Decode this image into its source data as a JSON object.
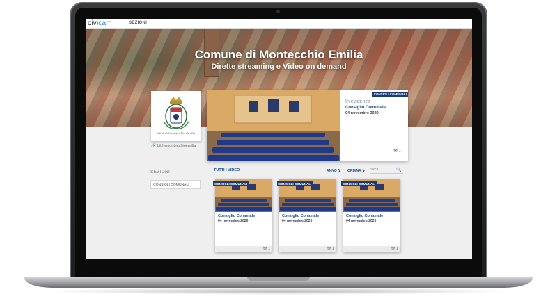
{
  "header": {
    "logo_prefix": "civi",
    "logo_accent": "cam",
    "nav_label": "SEZIONI"
  },
  "hero": {
    "title": "Comune di Montecchio Emilia",
    "subtitle": "Dirette streaming e Video on demand"
  },
  "crest": {
    "link_text": "bit.ly/montecchioemilia",
    "crest_text": "Città di Montecchio Emilia"
  },
  "featured": {
    "badge": "CONSIGLI COMUNALI",
    "label": "In evidenza",
    "title": "Consiglio Comunale",
    "date": "04 novembre 2020",
    "views": "1"
  },
  "sidebar": {
    "heading": "SEZIONI",
    "items": [
      {
        "label": "CONSIGLI COMUNALI"
      }
    ]
  },
  "toolbar": {
    "all_videos": "TUTTI I VIDEO",
    "anno": "ANNO",
    "ordina": "ORDINA",
    "search_placeholder": "cerca..."
  },
  "cards": [
    {
      "badge": "CONSIGLI COMUNALI",
      "title": "Consiglio Comunale",
      "date": "04 novembre 2020",
      "views": "1"
    },
    {
      "badge": "CONSIGLI COMUNALI",
      "title": "Consiglio Comunale",
      "date": "04 novembre 2020",
      "views": "1"
    },
    {
      "badge": "CONSIGLI COMUNALI",
      "title": "Consiglio Comunale",
      "date": "04 novembre 2020",
      "views": "1"
    }
  ],
  "colors": {
    "accent": "#1a4d8a",
    "badge_bg": "#1a3a7a",
    "logo_accent": "#1e88d8"
  },
  "icons": {
    "link": "link-icon",
    "search": "search-icon",
    "views": "eye-icon",
    "chevron": "chevron-right-icon"
  }
}
